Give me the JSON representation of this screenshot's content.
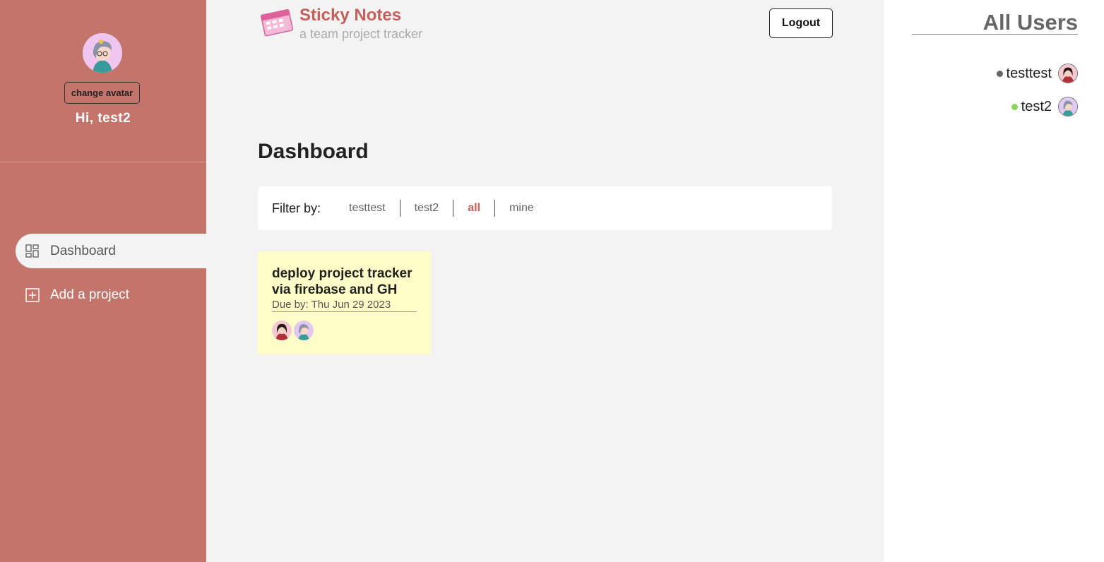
{
  "sidebar": {
    "change_avatar_label": "change avatar",
    "greeting": "Hi, test2",
    "nav": [
      {
        "label": "Dashboard",
        "icon": "dashboard-grid-icon",
        "active": true
      },
      {
        "label": "Add a project",
        "icon": "add-square-icon",
        "active": false
      }
    ],
    "bg_color": "#c4756b"
  },
  "header": {
    "title": "Sticky Notes",
    "subtitle": "a team project tracker",
    "logout_label": "Logout",
    "logo_icon": "calendar-icon"
  },
  "main": {
    "page_title": "Dashboard",
    "filter": {
      "label": "Filter by:",
      "options": [
        "testtest",
        "test2",
        "all",
        "mine"
      ],
      "selected": "all"
    },
    "projects": [
      {
        "title": "deploy project tracker via firebase and GH",
        "due": "Due by: Thu Jun 29 2023",
        "assignees": [
          "testtest",
          "test2"
        ]
      }
    ]
  },
  "users_panel": {
    "title": "All Users",
    "users": [
      {
        "name": "testtest",
        "status_color": "#666666"
      },
      {
        "name": "test2",
        "status_color": "#8bd35a"
      }
    ]
  }
}
